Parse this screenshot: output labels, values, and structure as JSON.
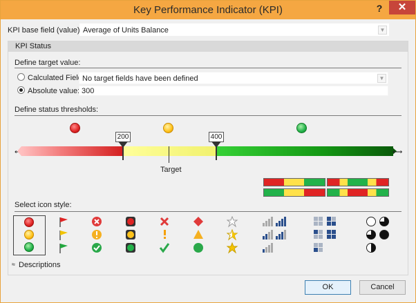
{
  "window": {
    "title": "Key Performance Indicator (KPI)",
    "help": "?",
    "close": "✕"
  },
  "base_field": {
    "label": "KPI base field (value):",
    "value": "Average of Units Balance"
  },
  "kpi_status": {
    "header": "KPI Status",
    "target_label": "Define target value:",
    "calculated": {
      "label": "Calculated Field:",
      "value": "No target fields have been defined",
      "selected": false
    },
    "absolute": {
      "label": "Absolute value:",
      "value": "300",
      "selected": true
    },
    "thresholds_label": "Define status thresholds:",
    "threshold_low": "200",
    "threshold_high": "400",
    "target_caption": "Target",
    "icon_style_label": "Select icon style:"
  },
  "descriptions_toggle": "Descriptions",
  "buttons": {
    "ok": "OK",
    "cancel": "Cancel"
  },
  "colors": {
    "titlebar": "#f5a742",
    "close": "#c7453a",
    "red": "#e02424",
    "yellow": "#ffc21a",
    "green": "#22b24a"
  },
  "icon_sets": [
    "traffic-light-circles",
    "flags",
    "symbols-circled",
    "traffic-light-rimmed",
    "symbols-uncircled",
    "shapes",
    "stars",
    "signal-bars",
    "quarters-boxes",
    "pie-quarters"
  ]
}
